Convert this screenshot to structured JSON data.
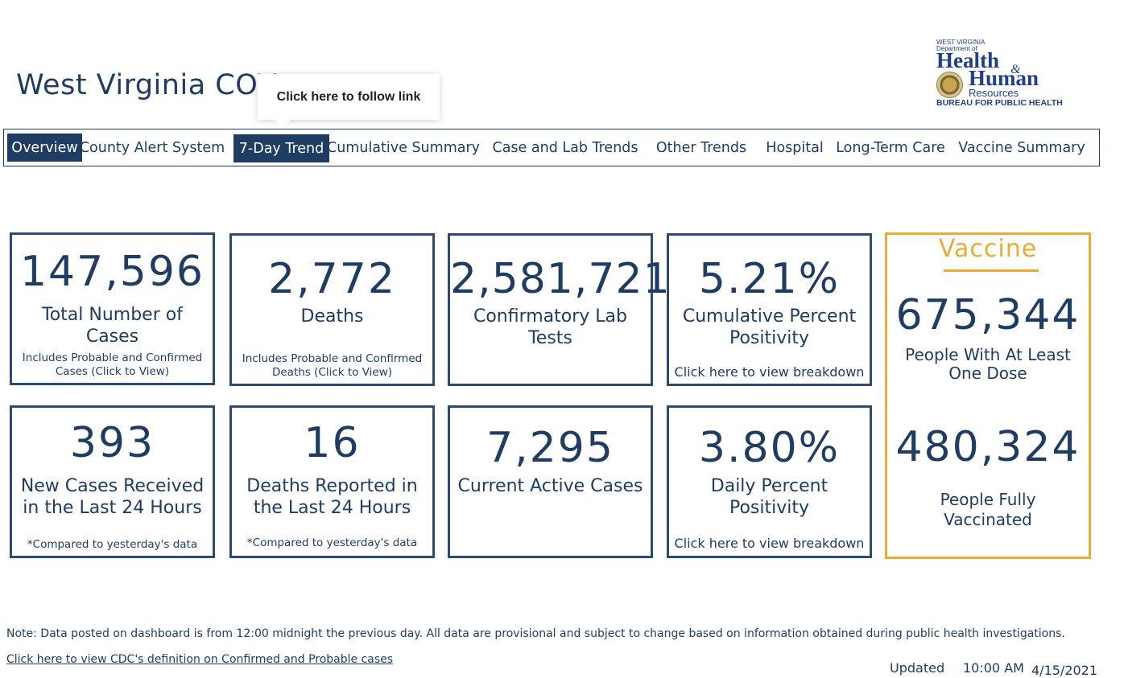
{
  "header": {
    "title": "West Virginia COV",
    "tooltip": "Click here to follow link"
  },
  "logo": {
    "line1": "WEST VIRGINIA",
    "line2": "Department of",
    "health": "Health",
    "amp": "&",
    "human": "Human",
    "resources": "Resources",
    "bureau": "BUREAU FOR PUBLIC HEALTH"
  },
  "nav": {
    "items": [
      {
        "label": "Overview",
        "active": true
      },
      {
        "label": "County Alert System",
        "active": false
      },
      {
        "label": "7-Day Trend",
        "active": true
      },
      {
        "label": "Cumulative Summary",
        "active": false
      },
      {
        "label": "Case and Lab Trends",
        "active": false
      },
      {
        "label": "Other Trends",
        "active": false
      },
      {
        "label": "Hospital",
        "active": false
      },
      {
        "label": "Long-Term Care",
        "active": false
      },
      {
        "label": "Vaccine Summary",
        "active": false
      }
    ]
  },
  "cards": {
    "total_cases": {
      "value": "147,596",
      "label_1": "Total Number of",
      "label_2": "Cases",
      "sub_1": "Includes Probable and Confirmed",
      "sub_2": "Cases (Click to View)"
    },
    "deaths": {
      "value": "2,772",
      "label_1": "Deaths",
      "sub_1": "Includes Probable and Confirmed",
      "sub_2": "Deaths (Click to View)"
    },
    "lab_tests": {
      "value": "2,581,721",
      "label_1": "Confirmatory Lab",
      "label_2": "Tests"
    },
    "cumulative_positivity": {
      "value": "5.21%",
      "label_1": "Cumulative Percent",
      "label_2": "Positivity",
      "link": "Click here to view breakdown"
    },
    "new_cases": {
      "value": "393",
      "label_1": "New Cases Received",
      "label_2": "in the Last 24 Hours",
      "sub_1": "*Compared to yesterday's data"
    },
    "new_deaths": {
      "value": "16",
      "label_1": "Deaths Reported in",
      "label_2": "the Last 24 Hours",
      "sub_1": "*Compared to yesterday's data"
    },
    "active_cases": {
      "value": "7,295",
      "label_1": "Current Active Cases"
    },
    "daily_positivity": {
      "value": "3.80%",
      "label_1": "Daily Percent",
      "label_2": "Positivity",
      "link": "Click here to view breakdown"
    }
  },
  "vaccine": {
    "title": "Vaccine",
    "one_dose_value": "675,344",
    "one_dose_label_1": "People With At Least",
    "one_dose_label_2": "One Dose",
    "full_value": "480,324",
    "full_label_1": "People Fully",
    "full_label_2": "Vaccinated"
  },
  "footer": {
    "note": "Note: Data posted on dashboard is from 12:00 midnight the previous day. All data are provisional and subject to change based on information obtained during public health investigations.",
    "cdc_link": "Click here to view CDC's definition on Confirmed and Probable cases",
    "updated_label": "Updated",
    "updated_time": "10:00 AM",
    "updated_date": "4/15/2021"
  },
  "colors": {
    "navy": "#1f3d63",
    "card_border": "#2d4a70",
    "vaccine_gold": "#e8ac35"
  }
}
